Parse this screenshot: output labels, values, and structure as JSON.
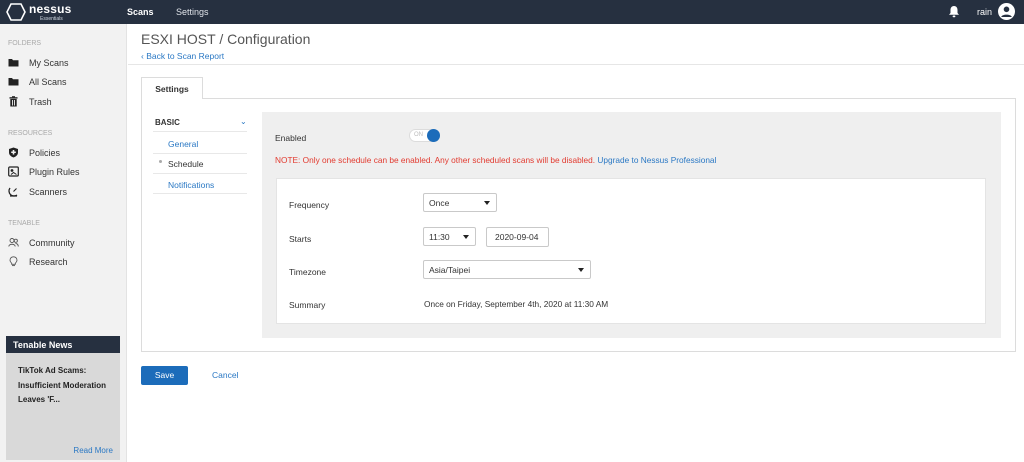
{
  "app": {
    "brand": "nessus",
    "edition": "Essentials"
  },
  "topnav": {
    "scans": "Scans",
    "settings": "Settings",
    "username": "rain"
  },
  "sidebar": {
    "folders_header": "FOLDERS",
    "folders": [
      {
        "label": "My Scans",
        "icon": "folder-icon"
      },
      {
        "label": "All Scans",
        "icon": "folder-icon"
      },
      {
        "label": "Trash",
        "icon": "trash-icon"
      }
    ],
    "resources_header": "RESOURCES",
    "resources": [
      {
        "label": "Policies",
        "icon": "shield-icon"
      },
      {
        "label": "Plugin Rules",
        "icon": "plugin-icon"
      },
      {
        "label": "Scanners",
        "icon": "satellite-icon"
      }
    ],
    "tenable_header": "TENABLE",
    "tenable": [
      {
        "label": "Community",
        "icon": "people-icon"
      },
      {
        "label": "Research",
        "icon": "lightbulb-icon"
      }
    ],
    "news": {
      "title": "Tenable News",
      "headline": "TikTok Ad Scams: Insufficient Moderation Leaves 'F...",
      "read_more": "Read More"
    }
  },
  "page": {
    "title": "ESXI HOST / Configuration",
    "back_link": "Back to Scan Report"
  },
  "tabs": {
    "settings": "Settings"
  },
  "settings_menu": {
    "section": "BASIC",
    "items": [
      "General",
      "Schedule",
      "Notifications"
    ]
  },
  "schedule": {
    "enabled_label": "Enabled",
    "toggle_text": "ON",
    "note": "NOTE: Only one schedule can be enabled. Any other scheduled scans will be disabled.",
    "upgrade_link": "Upgrade to Nessus Professional",
    "frequency_label": "Frequency",
    "frequency_value": "Once",
    "starts_label": "Starts",
    "starts_time": "11:30",
    "starts_date": "2020-09-04",
    "timezone_label": "Timezone",
    "timezone_value": "Asia/Taipei",
    "summary_label": "Summary",
    "summary_value": "Once on Friday, September 4th, 2020 at 11:30 AM"
  },
  "actions": {
    "save": "Save",
    "cancel": "Cancel"
  },
  "colors": {
    "topbar": "#263040",
    "primary": "#1c6cba",
    "link": "#2a78c4",
    "note": "#e23a2f"
  }
}
